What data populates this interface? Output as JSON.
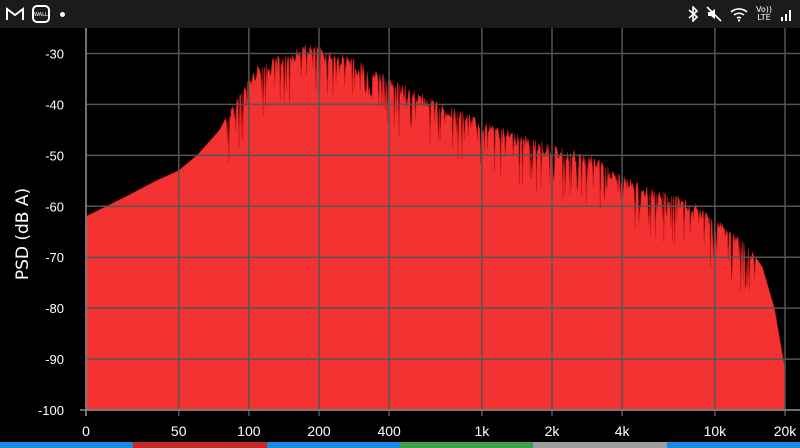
{
  "status_bar": {
    "left_icons": [
      "gmail-icon",
      "notification-app-icon",
      "more-notifications-dot"
    ],
    "notification_app_text": "WALL",
    "right_icons": [
      "bluetooth-icon",
      "mute-icon",
      "wifi-icon",
      "volte-indicator",
      "signal-icon"
    ],
    "volte_text": "Vo))\nLTE"
  },
  "chart_data": {
    "type": "area",
    "ylabel": "PSD (dB A)",
    "ylim": [
      -100,
      -25
    ],
    "yticks": [
      -30,
      -40,
      -50,
      -60,
      -70,
      -80,
      -90,
      -100
    ],
    "xscale": "log",
    "xlim": [
      20,
      20000
    ],
    "xticks": [
      {
        "value": 20,
        "label": "0"
      },
      {
        "value": 50,
        "label": "50"
      },
      {
        "value": 100,
        "label": "100"
      },
      {
        "value": 200,
        "label": "200"
      },
      {
        "value": 400,
        "label": "400"
      },
      {
        "value": 1000,
        "label": "1k"
      },
      {
        "value": 2000,
        "label": "2k"
      },
      {
        "value": 4000,
        "label": "4k"
      },
      {
        "value": 10000,
        "label": "10k"
      },
      {
        "value": 20000,
        "label": "20k"
      }
    ],
    "grid": true,
    "fill_color": "#f43232",
    "outline_color": "#c41a1a",
    "envelope": [
      {
        "x": 20,
        "y": -62
      },
      {
        "x": 30,
        "y": -58
      },
      {
        "x": 40,
        "y": -55
      },
      {
        "x": 50,
        "y": -53
      },
      {
        "x": 60,
        "y": -50
      },
      {
        "x": 75,
        "y": -45
      },
      {
        "x": 90,
        "y": -38
      },
      {
        "x": 110,
        "y": -32
      },
      {
        "x": 140,
        "y": -30
      },
      {
        "x": 180,
        "y": -28
      },
      {
        "x": 250,
        "y": -30
      },
      {
        "x": 350,
        "y": -33
      },
      {
        "x": 500,
        "y": -37
      },
      {
        "x": 700,
        "y": -40
      },
      {
        "x": 1000,
        "y": -43
      },
      {
        "x": 1500,
        "y": -46
      },
      {
        "x": 2000,
        "y": -48
      },
      {
        "x": 3000,
        "y": -50
      },
      {
        "x": 4000,
        "y": -54
      },
      {
        "x": 6000,
        "y": -57
      },
      {
        "x": 8000,
        "y": -59
      },
      {
        "x": 10000,
        "y": -62
      },
      {
        "x": 12000,
        "y": -65
      },
      {
        "x": 14000,
        "y": -68
      },
      {
        "x": 16000,
        "y": -72
      },
      {
        "x": 18000,
        "y": -80
      },
      {
        "x": 20000,
        "y": -92
      }
    ]
  },
  "bottom_strip_colors": [
    "#1e88e5",
    "#1e88e5",
    "#c62828",
    "#c62828",
    "#1e88e5",
    "#1e88e5",
    "#43a047",
    "#43a047",
    "#9e9e9e",
    "#9e9e9e",
    "#1e88e5",
    "#1e88e5"
  ]
}
